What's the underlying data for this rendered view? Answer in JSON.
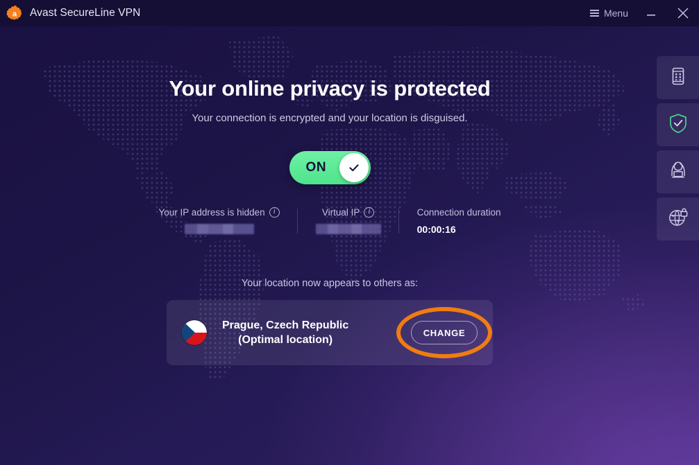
{
  "window": {
    "app_title": "Avast SecureLine VPN",
    "logo_letter": "a",
    "logo_color": "#f4801e",
    "menu_label": "Menu",
    "minimize_label": "Minimize",
    "close_label": "Close"
  },
  "hero": {
    "headline": "Your online privacy is protected",
    "subheadline": "Your connection is encrypted and your location is disguised."
  },
  "toggle": {
    "state_label": "ON",
    "state": "on",
    "on_color": "#56e894"
  },
  "info": {
    "ip": {
      "label": "Your IP address is hidden",
      "value": "",
      "redacted": true
    },
    "virtual_ip": {
      "label": "Virtual IP",
      "value": "",
      "redacted": true
    },
    "duration": {
      "label": "Connection duration",
      "value": "00:00:16"
    }
  },
  "location": {
    "caption": "Your location now appears to others as:",
    "name": "Prague, Czech Republic",
    "sub": "(Optimal location)",
    "flag": "czech-republic-flag-icon",
    "change_label": "CHANGE",
    "highlight_color": "#f07c12"
  },
  "rail": {
    "items": [
      {
        "icon": "device-tablet-icon",
        "name": "devices"
      },
      {
        "icon": "shield-check-icon",
        "name": "protection-status",
        "accent": "#4fd490"
      },
      {
        "icon": "hacker-laptop-icon",
        "name": "threat-protection"
      },
      {
        "icon": "globe-lock-icon",
        "name": "secure-browsing"
      }
    ]
  }
}
